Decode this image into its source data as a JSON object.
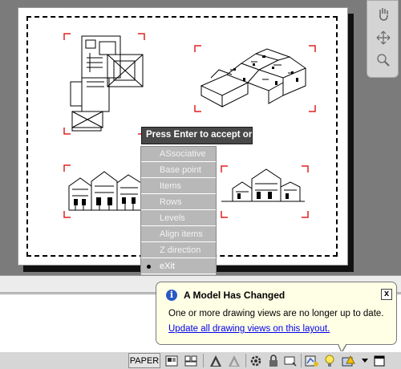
{
  "prompt": {
    "text": "Press Enter to accept or"
  },
  "menu": {
    "items": [
      {
        "label": "ASsociative"
      },
      {
        "label": "Base point"
      },
      {
        "label": "Items"
      },
      {
        "label": "Rows"
      },
      {
        "label": "Levels"
      },
      {
        "label": "Align items"
      },
      {
        "label": "Z direction"
      },
      {
        "label": "eXit",
        "current": true
      }
    ]
  },
  "balloon": {
    "title": "A Model Has Changed",
    "message": "One or more drawing views are no longer up to date.",
    "link": "Update all drawing views on this layout.",
    "close_label": "x",
    "info_glyph": "i"
  },
  "status_bar": {
    "space_label": "PAPER"
  },
  "colors": {
    "viewport_corner": "#e02020",
    "balloon_bg": "#ffffe6",
    "link": "#0000ee",
    "info": "#2a58c6"
  },
  "icons": [
    "pan-hand-icon",
    "orbit-icon",
    "zoom-extents-icon",
    "quick-view-layouts-icon",
    "quick-view-drawings-icon",
    "annotation-scale-icon",
    "annotation-visibility-icon",
    "workspace-gear-icon",
    "lock-icon",
    "hardware-accel-icon",
    "drawing-update-icon",
    "bulb-icon",
    "alert-icon",
    "menu-arrow-icon",
    "clean-screen-icon"
  ]
}
